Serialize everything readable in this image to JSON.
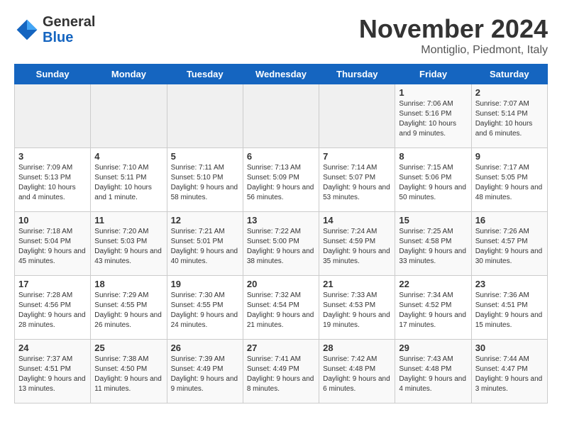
{
  "logo": {
    "line1": "General",
    "line2": "Blue"
  },
  "title": "November 2024",
  "location": "Montiglio, Piedmont, Italy",
  "days_of_week": [
    "Sunday",
    "Monday",
    "Tuesday",
    "Wednesday",
    "Thursday",
    "Friday",
    "Saturday"
  ],
  "weeks": [
    [
      {
        "day": "",
        "info": ""
      },
      {
        "day": "",
        "info": ""
      },
      {
        "day": "",
        "info": ""
      },
      {
        "day": "",
        "info": ""
      },
      {
        "day": "",
        "info": ""
      },
      {
        "day": "1",
        "info": "Sunrise: 7:06 AM\nSunset: 5:16 PM\nDaylight: 10 hours and 9 minutes."
      },
      {
        "day": "2",
        "info": "Sunrise: 7:07 AM\nSunset: 5:14 PM\nDaylight: 10 hours and 6 minutes."
      }
    ],
    [
      {
        "day": "3",
        "info": "Sunrise: 7:09 AM\nSunset: 5:13 PM\nDaylight: 10 hours and 4 minutes."
      },
      {
        "day": "4",
        "info": "Sunrise: 7:10 AM\nSunset: 5:11 PM\nDaylight: 10 hours and 1 minute."
      },
      {
        "day": "5",
        "info": "Sunrise: 7:11 AM\nSunset: 5:10 PM\nDaylight: 9 hours and 58 minutes."
      },
      {
        "day": "6",
        "info": "Sunrise: 7:13 AM\nSunset: 5:09 PM\nDaylight: 9 hours and 56 minutes."
      },
      {
        "day": "7",
        "info": "Sunrise: 7:14 AM\nSunset: 5:07 PM\nDaylight: 9 hours and 53 minutes."
      },
      {
        "day": "8",
        "info": "Sunrise: 7:15 AM\nSunset: 5:06 PM\nDaylight: 9 hours and 50 minutes."
      },
      {
        "day": "9",
        "info": "Sunrise: 7:17 AM\nSunset: 5:05 PM\nDaylight: 9 hours and 48 minutes."
      }
    ],
    [
      {
        "day": "10",
        "info": "Sunrise: 7:18 AM\nSunset: 5:04 PM\nDaylight: 9 hours and 45 minutes."
      },
      {
        "day": "11",
        "info": "Sunrise: 7:20 AM\nSunset: 5:03 PM\nDaylight: 9 hours and 43 minutes."
      },
      {
        "day": "12",
        "info": "Sunrise: 7:21 AM\nSunset: 5:01 PM\nDaylight: 9 hours and 40 minutes."
      },
      {
        "day": "13",
        "info": "Sunrise: 7:22 AM\nSunset: 5:00 PM\nDaylight: 9 hours and 38 minutes."
      },
      {
        "day": "14",
        "info": "Sunrise: 7:24 AM\nSunset: 4:59 PM\nDaylight: 9 hours and 35 minutes."
      },
      {
        "day": "15",
        "info": "Sunrise: 7:25 AM\nSunset: 4:58 PM\nDaylight: 9 hours and 33 minutes."
      },
      {
        "day": "16",
        "info": "Sunrise: 7:26 AM\nSunset: 4:57 PM\nDaylight: 9 hours and 30 minutes."
      }
    ],
    [
      {
        "day": "17",
        "info": "Sunrise: 7:28 AM\nSunset: 4:56 PM\nDaylight: 9 hours and 28 minutes."
      },
      {
        "day": "18",
        "info": "Sunrise: 7:29 AM\nSunset: 4:55 PM\nDaylight: 9 hours and 26 minutes."
      },
      {
        "day": "19",
        "info": "Sunrise: 7:30 AM\nSunset: 4:55 PM\nDaylight: 9 hours and 24 minutes."
      },
      {
        "day": "20",
        "info": "Sunrise: 7:32 AM\nSunset: 4:54 PM\nDaylight: 9 hours and 21 minutes."
      },
      {
        "day": "21",
        "info": "Sunrise: 7:33 AM\nSunset: 4:53 PM\nDaylight: 9 hours and 19 minutes."
      },
      {
        "day": "22",
        "info": "Sunrise: 7:34 AM\nSunset: 4:52 PM\nDaylight: 9 hours and 17 minutes."
      },
      {
        "day": "23",
        "info": "Sunrise: 7:36 AM\nSunset: 4:51 PM\nDaylight: 9 hours and 15 minutes."
      }
    ],
    [
      {
        "day": "24",
        "info": "Sunrise: 7:37 AM\nSunset: 4:51 PM\nDaylight: 9 hours and 13 minutes."
      },
      {
        "day": "25",
        "info": "Sunrise: 7:38 AM\nSunset: 4:50 PM\nDaylight: 9 hours and 11 minutes."
      },
      {
        "day": "26",
        "info": "Sunrise: 7:39 AM\nSunset: 4:49 PM\nDaylight: 9 hours and 9 minutes."
      },
      {
        "day": "27",
        "info": "Sunrise: 7:41 AM\nSunset: 4:49 PM\nDaylight: 9 hours and 8 minutes."
      },
      {
        "day": "28",
        "info": "Sunrise: 7:42 AM\nSunset: 4:48 PM\nDaylight: 9 hours and 6 minutes."
      },
      {
        "day": "29",
        "info": "Sunrise: 7:43 AM\nSunset: 4:48 PM\nDaylight: 9 hours and 4 minutes."
      },
      {
        "day": "30",
        "info": "Sunrise: 7:44 AM\nSunset: 4:47 PM\nDaylight: 9 hours and 3 minutes."
      }
    ]
  ]
}
